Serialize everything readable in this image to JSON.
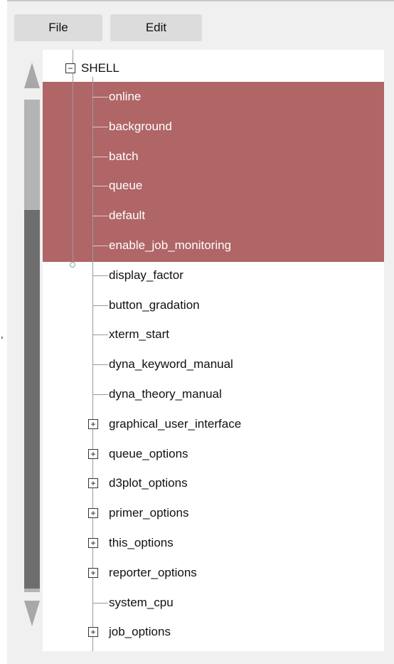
{
  "left_edge_glyph": "’",
  "menu": {
    "file_label": "File",
    "edit_label": "Edit"
  },
  "tree": {
    "root": {
      "label": "SHELL",
      "expanded": true,
      "expander_symbol": "−"
    },
    "selection_color": "#b06566",
    "expand_symbol": "+",
    "items": [
      {
        "label": "online",
        "selected": true,
        "group": false
      },
      {
        "label": "background",
        "selected": true,
        "group": false
      },
      {
        "label": "batch",
        "selected": true,
        "group": false
      },
      {
        "label": "queue",
        "selected": true,
        "group": false
      },
      {
        "label": "default",
        "selected": true,
        "group": false
      },
      {
        "label": "enable_job_monitoring",
        "selected": true,
        "group": false
      },
      {
        "label": "display_factor",
        "selected": false,
        "group": false
      },
      {
        "label": "button_gradation",
        "selected": false,
        "group": false
      },
      {
        "label": "xterm_start",
        "selected": false,
        "group": false
      },
      {
        "label": "dyna_keyword_manual",
        "selected": false,
        "group": false
      },
      {
        "label": "dyna_theory_manual",
        "selected": false,
        "group": false
      },
      {
        "label": "graphical_user_interface",
        "selected": false,
        "group": true
      },
      {
        "label": "queue_options",
        "selected": false,
        "group": true
      },
      {
        "label": "d3plot_options",
        "selected": false,
        "group": true
      },
      {
        "label": "primer_options",
        "selected": false,
        "group": true
      },
      {
        "label": "this_options",
        "selected": false,
        "group": true
      },
      {
        "label": "reporter_options",
        "selected": false,
        "group": true
      },
      {
        "label": "system_cpu",
        "selected": false,
        "group": false
      },
      {
        "label": "job_options",
        "selected": false,
        "group": true
      }
    ]
  }
}
